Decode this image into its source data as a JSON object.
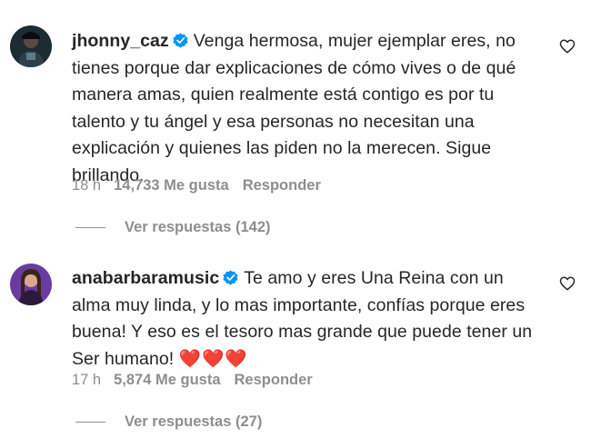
{
  "comments": [
    {
      "username": "jhonny_caz",
      "text": "Venga hermosa, mujer ejemplar eres, no tienes porque dar explicaciones de cómo vives o de qué manera amas, quien realmente está contigo es por tu talento y tu ángel y esa personas no necesitan una explicación y quienes las piden no la merecen. Sigue brillando.",
      "emoji": "",
      "time": "18 h",
      "likes": "14,733 Me gusta",
      "reply_label": "Responder",
      "view_replies": "Ver respuestas (142)",
      "avatar_icon": "avatar-dark-portrait-icon"
    },
    {
      "username": "anabarbaramusic",
      "text": "Te amo y eres Una Reina con un alma muy linda, y lo mas importante, confías porque eres buena! Y eso es el tesoro mas grande que puede tener un Ser humano!",
      "emoji": "❤️❤️❤️",
      "time": "17 h",
      "likes": "5,874 Me gusta",
      "reply_label": "Responder",
      "view_replies": "Ver respuestas (27)",
      "avatar_icon": "avatar-purple-portrait-icon"
    }
  ],
  "colors": {
    "text": "#262626",
    "secondary": "#8e8e8e",
    "verified": "#0095f6"
  }
}
